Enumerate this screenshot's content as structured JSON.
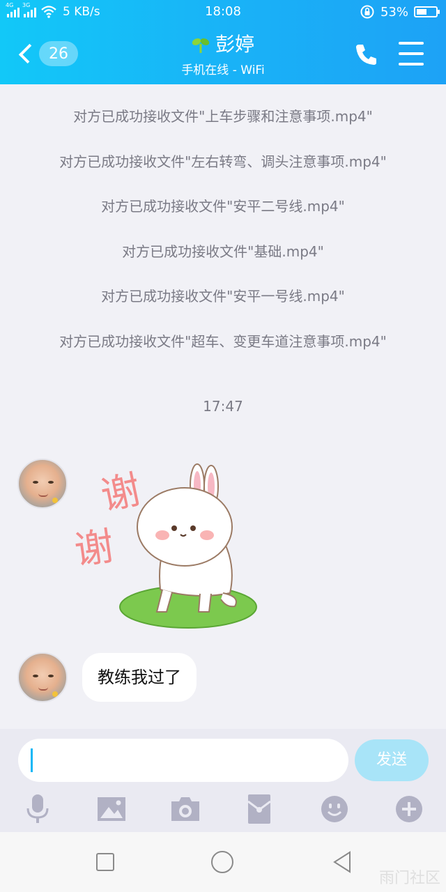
{
  "status_bar": {
    "network_1": "4G",
    "network_2": "3G",
    "speed": "5 KB/s",
    "time": "18:08",
    "battery": "53%",
    "battery_level": 0.53
  },
  "header": {
    "unread_count": "26",
    "contact_name": "彭婷",
    "status": "手机在线 - WiFi"
  },
  "system_messages": [
    "对方已成功接收文件\"上车步骤和注意事项.mp4\"",
    "对方已成功接收文件\"左右转弯、调头注意事项.mp4\"",
    "对方已成功接收文件\"安平二号线.mp4\"",
    "对方已成功接收文件\"基础.mp4\"",
    "对方已成功接收文件\"安平一号线.mp4\"",
    "对方已成功接收文件\"超车、变更车道注意事项.mp4\""
  ],
  "timestamp": "17:47",
  "sticker": {
    "text_1": "谢",
    "text_2": "谢"
  },
  "message": "教练我过了",
  "input": {
    "value": "",
    "send_label": "发送"
  },
  "toolbar_icons": [
    "mic-icon",
    "image-icon",
    "camera-icon",
    "red-packet-icon",
    "emoji-icon",
    "plus-icon"
  ],
  "watermark": "雨门社区",
  "colors": {
    "accent": "#12b7f5",
    "send_disabled": "#a8e4f8"
  }
}
